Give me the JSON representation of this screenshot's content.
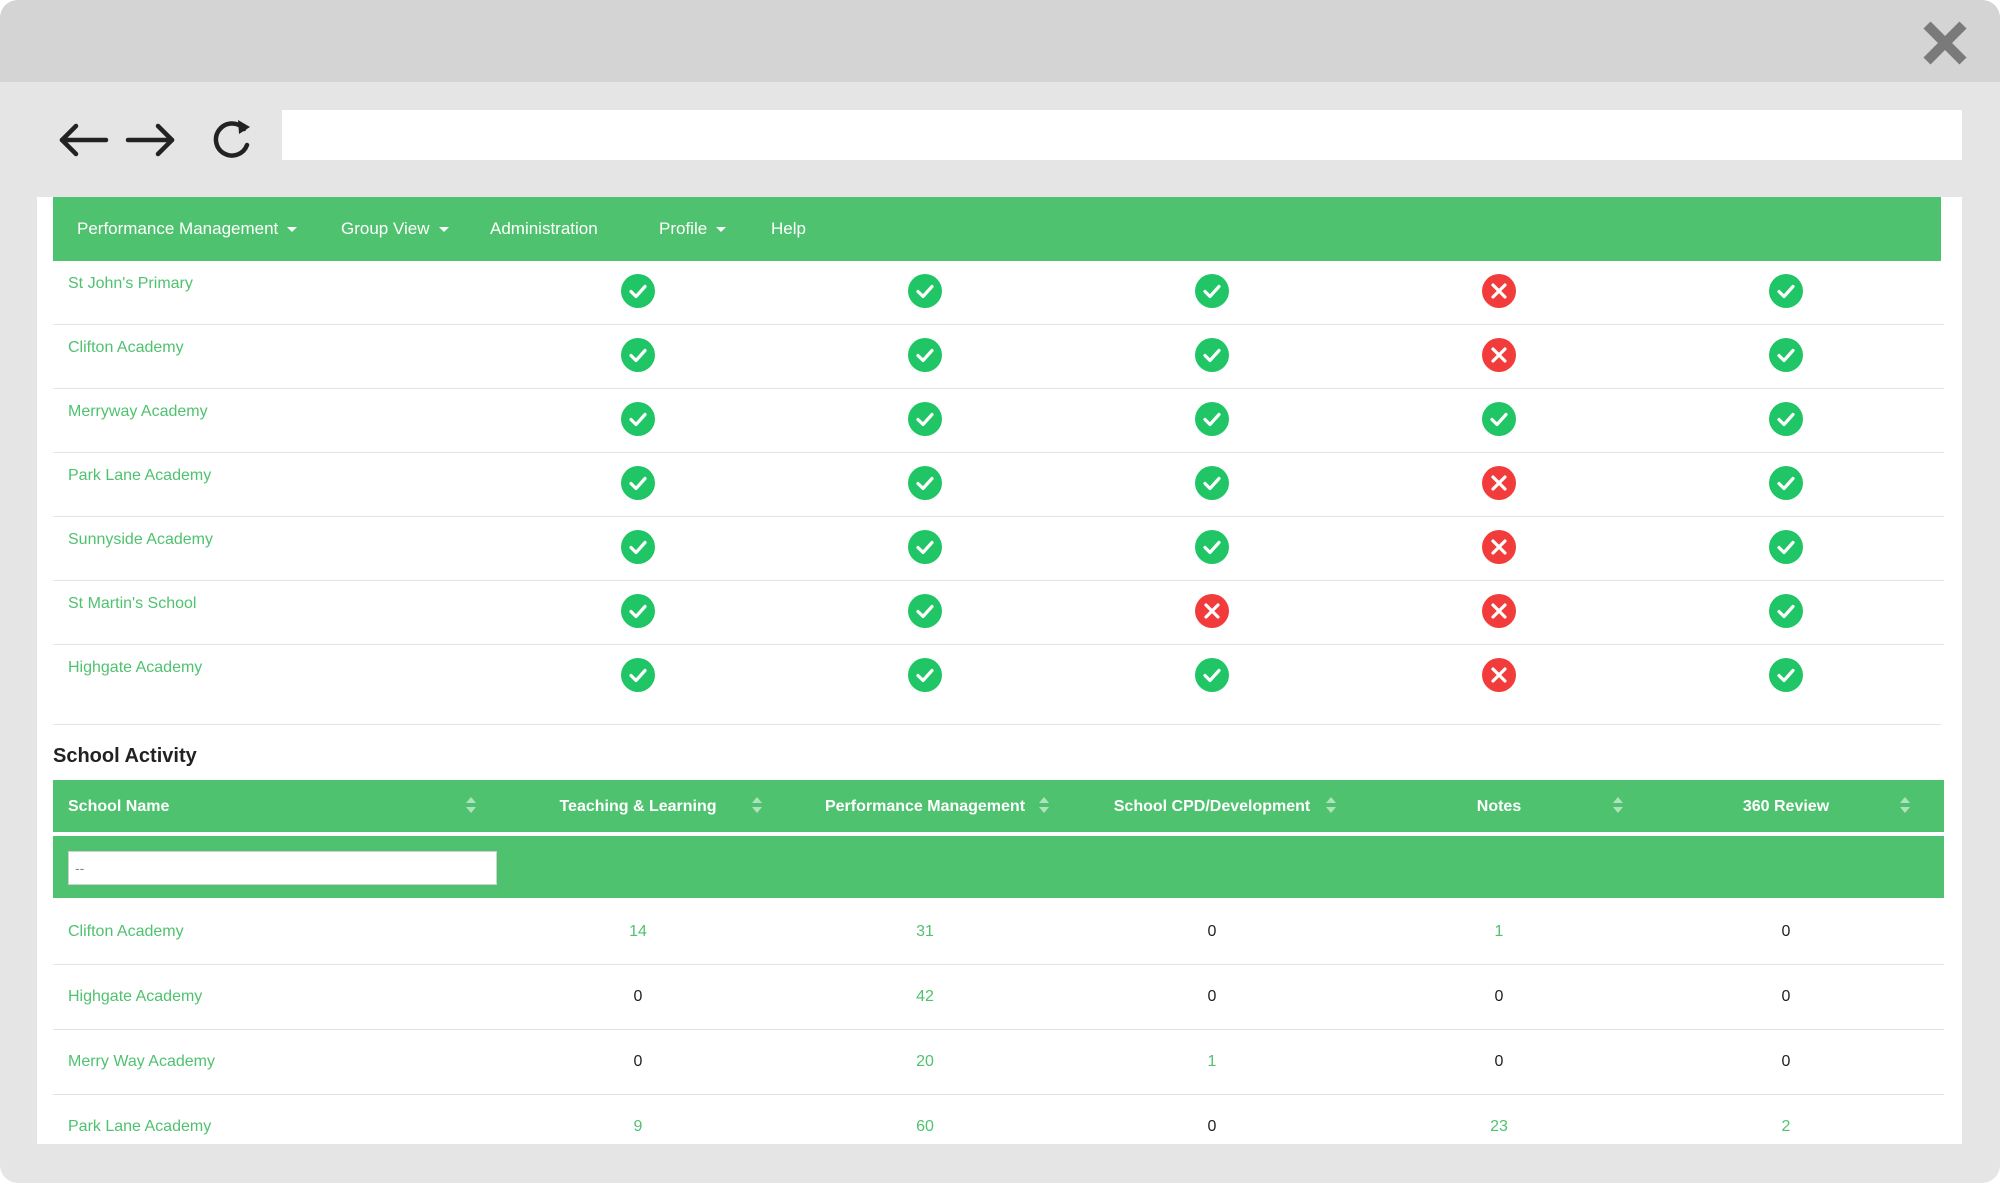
{
  "browser": {
    "address_value": ""
  },
  "colors": {
    "brand_green": "#4fc26f",
    "check_green": "#20c565",
    "cross_red": "#f23b3b",
    "window_chrome": "#e6e5e6",
    "titlebar": "#d4d4d4"
  },
  "icons": {
    "close": "close-x-icon",
    "back": "arrow-left-icon",
    "forward": "arrow-right-icon",
    "reload": "reload-icon",
    "ok": "check-circle-icon",
    "fail": "cross-circle-icon",
    "sort": "sort-icon"
  },
  "nav": {
    "items": [
      {
        "label": "Performance Management",
        "dropdown": true
      },
      {
        "label": "Group View",
        "dropdown": true
      },
      {
        "label": "Administration",
        "dropdown": false
      },
      {
        "label": "Profile",
        "dropdown": true
      },
      {
        "label": "Help",
        "dropdown": false
      }
    ]
  },
  "status_table": {
    "rows": [
      {
        "school": "St John's Primary",
        "statuses": [
          true,
          true,
          true,
          false,
          true
        ]
      },
      {
        "school": "Clifton Academy",
        "statuses": [
          true,
          true,
          true,
          false,
          true
        ]
      },
      {
        "school": "Merryway Academy",
        "statuses": [
          true,
          true,
          true,
          true,
          true
        ]
      },
      {
        "school": "Park Lane Academy",
        "statuses": [
          true,
          true,
          true,
          false,
          true
        ]
      },
      {
        "school": "Sunnyside Academy",
        "statuses": [
          true,
          true,
          true,
          false,
          true
        ]
      },
      {
        "school": "St Martin's School",
        "statuses": [
          true,
          true,
          false,
          false,
          true
        ]
      },
      {
        "school": "Highgate Academy",
        "statuses": [
          true,
          true,
          true,
          false,
          true
        ]
      }
    ]
  },
  "activity": {
    "title": "School Activity",
    "columns": [
      "School Name",
      "Teaching & Learning",
      "Performance Management",
      "School CPD/Development",
      "Notes",
      "360 Review"
    ],
    "filter": {
      "placeholder": "--",
      "value": ""
    },
    "rows": [
      {
        "school": "Clifton Academy",
        "values": [
          "14",
          "31",
          "0",
          "1",
          "0"
        ]
      },
      {
        "school": "Highgate Academy",
        "values": [
          "0",
          "42",
          "0",
          "0",
          "0"
        ]
      },
      {
        "school": "Merry Way Academy",
        "values": [
          "0",
          "20",
          "1",
          "0",
          "0"
        ]
      },
      {
        "school": "Park Lane Academy",
        "values": [
          "9",
          "60",
          "0",
          "23",
          "2"
        ]
      }
    ]
  }
}
